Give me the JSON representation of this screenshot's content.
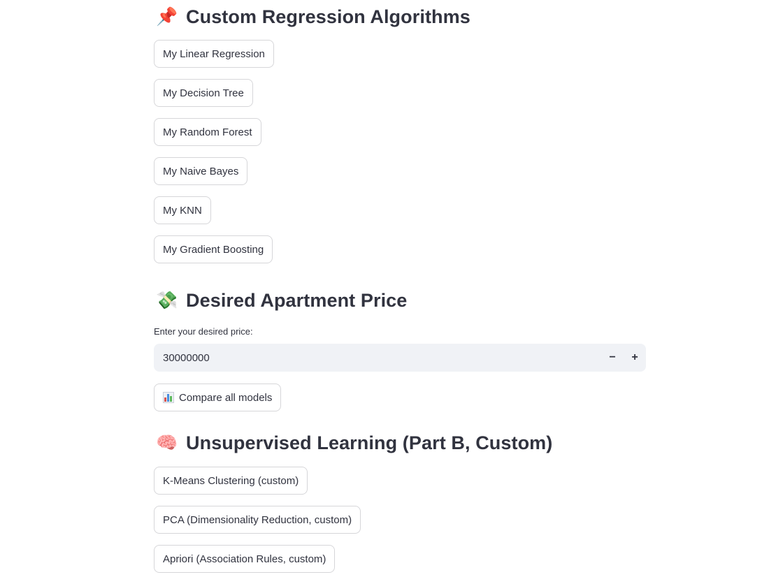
{
  "sections": {
    "regression": {
      "title": "Custom Regression Algorithms",
      "emoji": "📌",
      "buttons": [
        "My Linear Regression",
        "My Decision Tree",
        "My Random Forest",
        "My Naive Bayes",
        "My KNN",
        "My Gradient Boosting"
      ]
    },
    "price": {
      "title": "Desired Apartment Price",
      "emoji": "💸",
      "input_label": "Enter your desired price:",
      "input_value": "30000000",
      "decrement_label": "−",
      "increment_label": "+",
      "compare_button": "Compare all models",
      "compare_icon": "bar-chart-icon"
    },
    "unsupervised": {
      "title": "Unsupervised Learning (Part B, Custom)",
      "emoji": "🧠",
      "buttons": [
        "K-Means Clustering (custom)",
        "PCA (Dimensionality Reduction, custom)",
        "Apriori (Association Rules, custom)"
      ]
    }
  },
  "colors": {
    "text": "#31333f",
    "input_bg": "#f0f2f6",
    "button_border": "#d6d6d9"
  }
}
